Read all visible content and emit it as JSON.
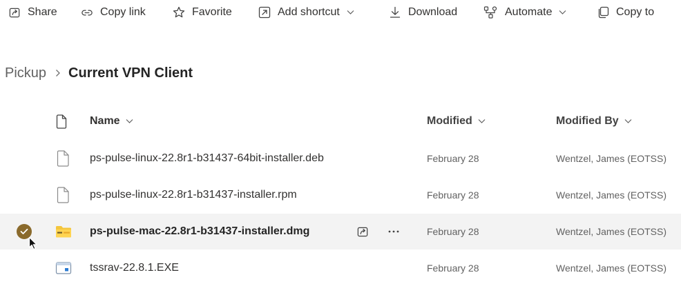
{
  "toolbar": {
    "items": [
      {
        "label": "Share",
        "icon": "share-icon"
      },
      {
        "label": "Copy link",
        "icon": "link-icon"
      },
      {
        "label": "Favorite",
        "icon": "star-icon"
      },
      {
        "label": "Add shortcut",
        "icon": "add-shortcut-icon",
        "has_dropdown": true
      },
      {
        "label": "Download",
        "icon": "download-icon"
      },
      {
        "label": "Automate",
        "icon": "automate-icon",
        "has_dropdown": true
      },
      {
        "label": "Copy to",
        "icon": "copy-icon"
      }
    ]
  },
  "breadcrumb": {
    "parent": "Pickup",
    "current": "Current VPN Client"
  },
  "list": {
    "columns": {
      "name": "Name",
      "modified": "Modified",
      "modified_by": "Modified By"
    },
    "rows": [
      {
        "name": "ps-pulse-linux-22.8r1-b31437-64bit-installer.deb",
        "modified": "February 28",
        "modified_by": "Wentzel, James (EOTSS)",
        "icon": "generic-file-icon",
        "selected": false
      },
      {
        "name": "ps-pulse-linux-22.8r1-b31437-installer.rpm",
        "modified": "February 28",
        "modified_by": "Wentzel, James (EOTSS)",
        "icon": "generic-file-icon",
        "selected": false
      },
      {
        "name": "ps-pulse-mac-22.8r1-b31437-installer.dmg",
        "modified": "February 28",
        "modified_by": "Wentzel, James (EOTSS)",
        "icon": "zip-folder-icon",
        "selected": true
      },
      {
        "name": "tssrav-22.8.1.EXE",
        "modified": "February 28",
        "modified_by": "Wentzel, James (EOTSS)",
        "icon": "executable-file-icon",
        "selected": false
      }
    ]
  },
  "colors": {
    "text_primary": "#242424",
    "text_secondary": "#616161",
    "selected_row_bg": "#f3f3f3",
    "check_circle": "#8a6a2c",
    "zip_folder": "#f4c63d"
  }
}
